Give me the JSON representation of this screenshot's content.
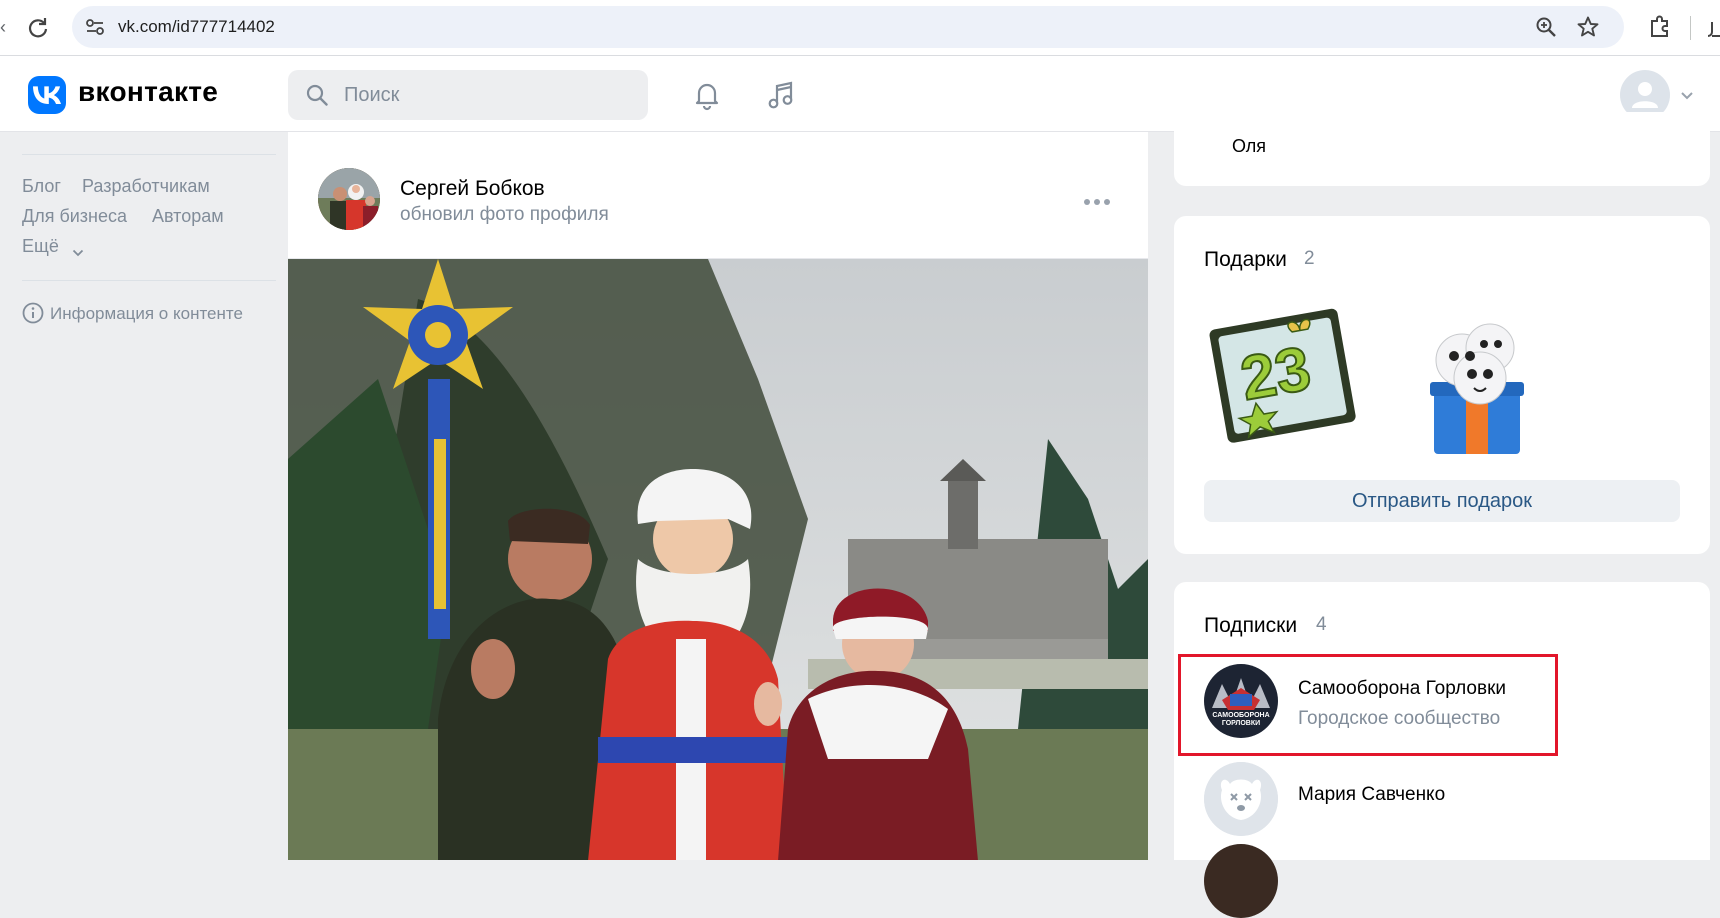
{
  "browser": {
    "url": "vk.com/id777714402"
  },
  "header": {
    "logo_text": "вконтакте",
    "search_placeholder": "Поиск",
    "accent_color": "#0077ff"
  },
  "left_nav": {
    "links": [
      "Блог",
      "Разработчикам",
      "Для бизнеса",
      "Авторам",
      "Ещё"
    ],
    "content_info": "Информация о контенте"
  },
  "post": {
    "author": "Сергей Бобков",
    "action": "обновил фото профиля"
  },
  "friends": {
    "visible_name": "Оля"
  },
  "gifts": {
    "title": "Подарки",
    "count": "2",
    "items": [
      "gift-23-box",
      "gift-sticker-box"
    ],
    "send_label": "Отправить подарок"
  },
  "subscriptions": {
    "title": "Подписки",
    "count": "4",
    "items": [
      {
        "name": "Самооборона Горловки",
        "desc": "Городское сообщество",
        "avatar_text": "САМООБОРОНА ГОРЛОВКИ"
      },
      {
        "name": "Мария Савченко",
        "desc": ""
      }
    ]
  },
  "highlight_color": "#e2162a"
}
